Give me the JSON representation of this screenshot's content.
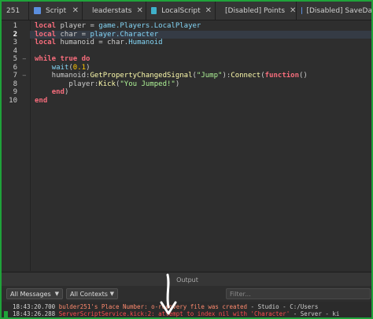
{
  "tabs": [
    {
      "label": "251",
      "icon": "script-icon",
      "closable": false
    },
    {
      "label": "Script",
      "icon": "script-icon",
      "closable": true
    },
    {
      "label": "leaderstats",
      "icon": "script-icon",
      "closable": true
    },
    {
      "label": "LocalScript",
      "icon": "localscript-icon",
      "closable": true
    },
    {
      "label": "[Disabled] Points",
      "icon": "script-icon",
      "closable": true
    },
    {
      "label": "[Disabled] SaveData",
      "icon": "script-icon",
      "closable": false
    }
  ],
  "editor": {
    "line_numbers": [
      "1",
      "2",
      "3",
      "4",
      "5",
      "6",
      "7",
      "8",
      "9",
      "10"
    ],
    "current_line": "2",
    "lines": [
      [
        "local",
        " ",
        "player",
        " = ",
        "game.Players.LocalPlayer"
      ],
      [
        "local",
        " ",
        "char",
        " = ",
        "player.Character"
      ],
      [
        "local",
        " ",
        "humanoid",
        " = char.",
        "Humanoid"
      ],
      [
        ""
      ],
      [
        "while",
        " ",
        "true",
        " ",
        "do"
      ],
      [
        "    ",
        "wait",
        "(",
        "0.1",
        ")"
      ],
      [
        "    humanoid:",
        "GetPropertyChangedSignal",
        "(",
        "\"Jump\"",
        "):",
        "Connect",
        "(",
        "function",
        "()"
      ],
      [
        "        player:",
        "Kick",
        "(",
        "\"You Jumped!\"",
        ")"
      ],
      [
        "    ",
        "end",
        ")"
      ],
      [
        "end"
      ]
    ]
  },
  "output": {
    "header": "Output",
    "filter_messages": "All Messages",
    "filter_contexts": "All Contexts",
    "filter_placeholder": "Filter...",
    "logs": [
      {
        "time": "18:43:20.700",
        "message": "bulder251's Place Number: ",
        "message_tail": "o-recovery file was created",
        "meta": "  -  Studio - C:/Users"
      },
      {
        "time": "18:43:26.288",
        "message": "ServerScriptService.kick:2: attempt to index nil with 'Character'",
        "meta": "  -  Server - ki"
      }
    ]
  },
  "colors": {
    "frame_border": "#1fa33a",
    "keyword": "#f86d7c",
    "builtin": "#84d6f7",
    "number": "#ffc600",
    "string": "#adf195",
    "method": "#fdfbac",
    "error": "#ff4c4c"
  }
}
